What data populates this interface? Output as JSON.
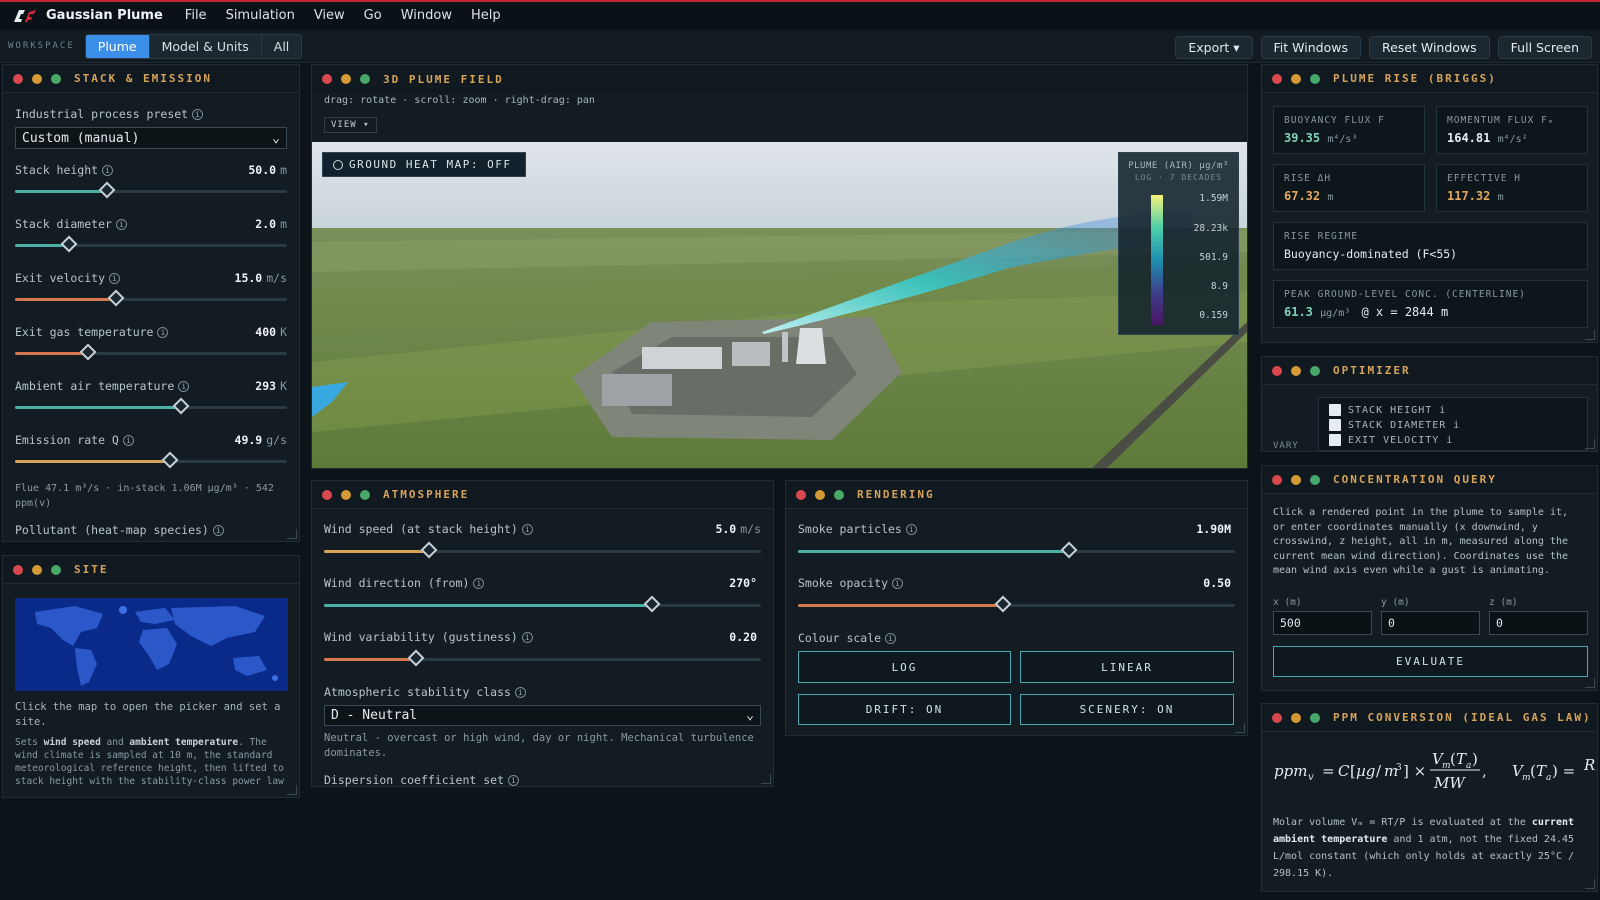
{
  "app": {
    "name": "Gaussian Plume",
    "menu": [
      "File",
      "Simulation",
      "View",
      "Go",
      "Window",
      "Help"
    ]
  },
  "toolbar": {
    "workspace_label": "WORKSPACE",
    "tabs": [
      "Plume",
      "Model & Units",
      "All"
    ],
    "active_tab": "Plume",
    "buttons": {
      "export": "Export ▾",
      "fit": "Fit Windows",
      "reset": "Reset Windows",
      "full": "Full Screen"
    }
  },
  "stack": {
    "title": "STACK & EMISSION",
    "preset_label": "Industrial process preset",
    "preset_value": "Custom (manual)",
    "sliders": [
      {
        "label": "Stack height",
        "value": "50.0",
        "unit": "m",
        "fraction": 0.34,
        "color": "#4bb0a6"
      },
      {
        "label": "Stack diameter",
        "value": "2.0",
        "unit": "m",
        "fraction": 0.2,
        "color": "#4bb0a6"
      },
      {
        "label": "Exit velocity",
        "value": "15.0",
        "unit": "m/s",
        "fraction": 0.37,
        "color": "#d6784f"
      },
      {
        "label": "Exit gas temperature",
        "value": "400",
        "unit": "K",
        "fraction": 0.27,
        "color": "#d6784f"
      },
      {
        "label": "Ambient air temperature",
        "value": "293",
        "unit": "K",
        "fraction": 0.61,
        "color": "#4bb0a6"
      },
      {
        "label": "Emission rate Q",
        "value": "49.9",
        "unit": "g/s",
        "fraction": 0.57,
        "color": "#d6a35a"
      }
    ],
    "flue_text": "Flue 47.1 m³/s · in-stack 1.06M µg/m³ · 542 ppm(v)",
    "pollutant_label": "Pollutant (heat-map species)"
  },
  "site": {
    "title": "SITE",
    "hint": "Click the map to open the picker and set a site.",
    "desc_pre": "Sets ",
    "b1": "wind speed",
    "mid": " and ",
    "b2": "ambient temperature",
    "desc_post": ". The wind climate is sampled at 10 m, the standard meteorological reference height, then lifted to stack height with the stability-class power law"
  },
  "plume3d": {
    "title": "3D PLUME FIELD",
    "hint": "drag: rotate · scroll: zoom · right-drag: pan",
    "view_btn": "VIEW ▾",
    "heatmap_btn": "GROUND HEAT MAP: OFF",
    "legend": {
      "title": "PLUME (AIR) µg/m³",
      "sub": "LOG · 7 DECADES",
      "ticks": [
        "1.59M",
        "28.23k",
        "501.9",
        "8.9",
        "0.159"
      ]
    }
  },
  "atmosphere": {
    "title": "ATMOSPHERE",
    "sliders": [
      {
        "label": "Wind speed (at stack height)",
        "value": "5.0",
        "unit": "m/s",
        "fraction": 0.24,
        "color": "#d6a35a"
      },
      {
        "label": "Wind direction (from)",
        "value": "270°",
        "unit": "",
        "fraction": 0.75,
        "color": "#4bb0a6"
      },
      {
        "label": "Wind variability (gustiness)",
        "value": "0.20",
        "unit": "",
        "fraction": 0.21,
        "color": "#d6784f"
      }
    ],
    "stability_label": "Atmospheric stability class",
    "stability_value": "D - Neutral",
    "stability_desc": "Neutral - overcast or high wind, day or night. Mechanical turbulence dominates.",
    "dispersion_label": "Dispersion coefficient set"
  },
  "rendering": {
    "title": "RENDERING",
    "sliders": [
      {
        "label": "Smoke particles",
        "value": "1.90M",
        "unit": "",
        "fraction": 0.62,
        "color": "#4bb0a6"
      },
      {
        "label": "Smoke opacity",
        "value": "0.50",
        "unit": "",
        "fraction": 0.47,
        "color": "#d6784f"
      }
    ],
    "colour_label": "Colour scale",
    "buttons": [
      "LOG",
      "LINEAR",
      "DRIFT: ON",
      "SCENERY: ON"
    ]
  },
  "rise": {
    "title": "PLUME RISE (BRIGGS)",
    "cards": [
      {
        "k": "BUOYANCY FLUX F",
        "v": "39.35",
        "u": "m⁴/s³",
        "color": "#7fd2b5"
      },
      {
        "k": "MOMENTUM FLUX Fₘ",
        "v": "164.81",
        "u": "m⁴/s²",
        "color": "#e6edf0"
      },
      {
        "k": "RISE ΔH",
        "v": "67.32",
        "u": "m",
        "color": "#e2a85b"
      },
      {
        "k": "EFFECTIVE H",
        "v": "117.32",
        "u": "m",
        "color": "#e2a85b"
      }
    ],
    "regime_k": "RISE REGIME",
    "regime_v": "Buoyancy-dominated (F<55)",
    "peak_k": "PEAK GROUND-LEVEL CONC. (CENTERLINE)",
    "peak_v": "61.3",
    "peak_u": "µg/m³",
    "peak_at": "@ x = 2844 m"
  },
  "optimizer": {
    "title": "OPTIMIZER",
    "vary": "VARY",
    "items": [
      "STACK HEIGHT i",
      "STACK DIAMETER i",
      "EXIT VELOCITY i"
    ]
  },
  "query": {
    "title": "CONCENTRATION QUERY",
    "desc": "Click a rendered point in the plume to sample it, or enter coordinates manually (x downwind, y crosswind, z height, all in m, measured along the current mean wind direction). Coordinates use the mean wind axis even while a gust is animating.",
    "fields": [
      {
        "label": "x (m)",
        "value": "500"
      },
      {
        "label": "y (m)",
        "value": "0"
      },
      {
        "label": "z (m)",
        "value": "0"
      }
    ],
    "evaluate": "EVALUATE"
  },
  "ppm": {
    "title": "PPM CONVERSION (IDEAL GAS LAW)",
    "desc_pre": "Molar volume Vₘ = RT/P is evaluated at the ",
    "b": "current ambient temperature",
    "desc_post": " and 1 atm, not the fixed 24.45 L/mol constant (which only holds at exactly 25°C / 298.15 K)."
  }
}
